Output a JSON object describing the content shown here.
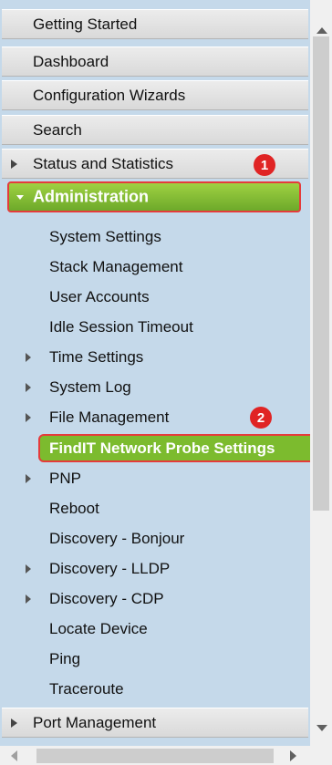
{
  "nav": {
    "top_items": [
      {
        "label": "Getting Started"
      },
      {
        "label": "Dashboard"
      },
      {
        "label": "Configuration Wizards"
      },
      {
        "label": "Search"
      }
    ],
    "status": {
      "label": "Status and Statistics",
      "badge": "1"
    },
    "administration": {
      "label": "Administration",
      "expanded": true
    },
    "sub_items": [
      {
        "label": "System Settings",
        "expandable": false
      },
      {
        "label": "Stack Management",
        "expandable": false
      },
      {
        "label": "User Accounts",
        "expandable": false
      },
      {
        "label": "Idle Session Timeout",
        "expandable": false
      },
      {
        "label": "Time Settings",
        "expandable": true
      },
      {
        "label": "System Log",
        "expandable": true
      },
      {
        "label": "File Management",
        "expandable": true
      }
    ],
    "selected": {
      "label": "FindIT Network Probe Settings",
      "badge": "2"
    },
    "sub_items_after": [
      {
        "label": "PNP",
        "expandable": true
      },
      {
        "label": "Reboot",
        "expandable": false
      },
      {
        "label": "Discovery - Bonjour",
        "expandable": false
      },
      {
        "label": "Discovery - LLDP",
        "expandable": true
      },
      {
        "label": "Discovery - CDP",
        "expandable": true
      },
      {
        "label": "Locate Device",
        "expandable": false
      },
      {
        "label": "Ping",
        "expandable": false
      },
      {
        "label": "Traceroute",
        "expandable": false
      }
    ],
    "port_management": {
      "label": "Port Management"
    }
  },
  "colors": {
    "accent_green": "#7cbb2e",
    "highlight_red": "#e53b3b",
    "panel_blue": "#c5d9ea"
  }
}
